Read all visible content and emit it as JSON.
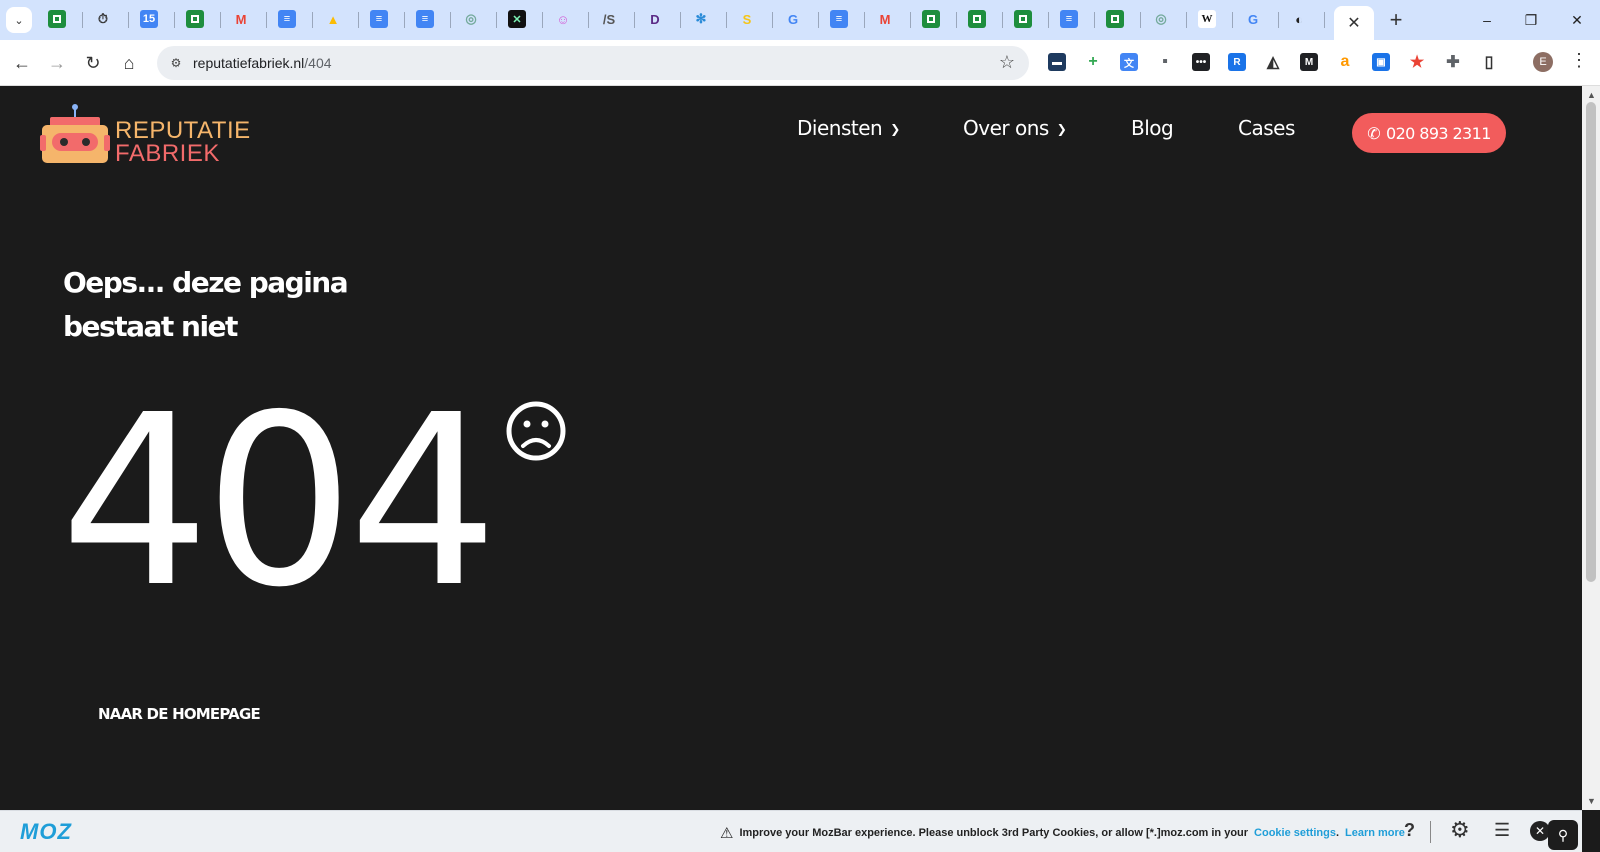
{
  "browser": {
    "url_domain": "reputatiefabriek.nl",
    "url_path": "/404",
    "avatar_letter": "E",
    "tab_close": "✕",
    "new_tab": "+",
    "window_controls": [
      "–",
      "❐",
      "✕"
    ],
    "tab_favicons": [
      {
        "icon": "sheets-icon",
        "glyph": "",
        "color": "#1e8e3e"
      },
      {
        "icon": "timer-icon",
        "glyph": "⏱",
        "color": "#333333"
      },
      {
        "icon": "calendar-icon",
        "glyph": "15",
        "color": "#4285f4"
      },
      {
        "icon": "sheets-icon",
        "glyph": "",
        "color": "#1e8e3e"
      },
      {
        "icon": "gmail-icon",
        "glyph": "M",
        "color": "#ea4335"
      },
      {
        "icon": "docs-icon",
        "glyph": "≡",
        "color": "#4285f4"
      },
      {
        "icon": "drive-icon",
        "glyph": "▲",
        "color": "#fbbc04"
      },
      {
        "icon": "docs-icon",
        "glyph": "≡",
        "color": "#4285f4"
      },
      {
        "icon": "docs-icon",
        "glyph": "≡",
        "color": "#4285f4"
      },
      {
        "icon": "chatgpt-icon",
        "glyph": "◎",
        "color": "#74aa9c"
      },
      {
        "icon": "x-app-icon",
        "glyph": "✕",
        "color": "#111111"
      },
      {
        "icon": "ai-icon",
        "glyph": "☺",
        "color": "#d35dd6"
      },
      {
        "icon": "as-icon",
        "glyph": "/S",
        "color": "#555555"
      },
      {
        "icon": "d-app-icon",
        "glyph": "D",
        "color": "#5b2a86"
      },
      {
        "icon": "flower-icon",
        "glyph": "✻",
        "color": "#2a8bd8"
      },
      {
        "icon": "s-app-icon",
        "glyph": "S",
        "color": "#f5c518"
      },
      {
        "icon": "google-icon",
        "glyph": "G",
        "color": "#4285f4"
      },
      {
        "icon": "docs-icon",
        "glyph": "≡",
        "color": "#4285f4"
      },
      {
        "icon": "gmail-icon",
        "glyph": "M",
        "color": "#ea4335"
      },
      {
        "icon": "sheets-icon",
        "glyph": "",
        "color": "#1e8e3e"
      },
      {
        "icon": "sheets-icon",
        "glyph": "",
        "color": "#1e8e3e"
      },
      {
        "icon": "sheets-icon",
        "glyph": "",
        "color": "#1e8e3e"
      },
      {
        "icon": "docs-icon",
        "glyph": "≡",
        "color": "#4285f4"
      },
      {
        "icon": "sheets-icon",
        "glyph": "",
        "color": "#1e8e3e"
      },
      {
        "icon": "chatgpt-icon",
        "glyph": "◎",
        "color": "#74aa9c"
      },
      {
        "icon": "wikipedia-icon",
        "glyph": "W",
        "color": "#ffffff"
      },
      {
        "icon": "google-icon",
        "glyph": "G",
        "color": "#4285f4"
      },
      {
        "icon": "cursor-icon",
        "glyph": "◐",
        "color": "#222222"
      }
    ],
    "extensions": [
      {
        "icon": "wallet-icon",
        "glyph": "▬",
        "color": "#1e3a5f"
      },
      {
        "icon": "plus-extension-icon",
        "glyph": "+",
        "color": "#34a853"
      },
      {
        "icon": "translate-icon",
        "glyph": "文",
        "color": "#4285f4"
      },
      {
        "icon": "stamp-icon",
        "glyph": "▪",
        "color": "#5f6368"
      },
      {
        "icon": "dots-extension-icon",
        "glyph": "•••",
        "color": "#202124"
      },
      {
        "icon": "r-extension-icon",
        "glyph": "R",
        "color": "#1a73e8"
      },
      {
        "icon": "bird-icon",
        "glyph": "◭",
        "color": "#333333"
      },
      {
        "icon": "m-extension-icon",
        "glyph": "M",
        "color": "#202124"
      },
      {
        "icon": "amazon-icon",
        "glyph": "a",
        "color": "#ff9900"
      },
      {
        "icon": "screen-extension-icon",
        "glyph": "▣",
        "color": "#1a73e8"
      },
      {
        "icon": "star-extension-icon",
        "glyph": "★",
        "color": "#ea4335"
      },
      {
        "icon": "puzzle-icon",
        "glyph": "✚",
        "color": "#5f6368"
      },
      {
        "icon": "sidepanel-icon",
        "glyph": "▯",
        "color": "#333333"
      }
    ]
  },
  "site": {
    "logo_line1": "REPUTATIE",
    "logo_line2": "FABRIEK",
    "nav": {
      "diensten": "Diensten",
      "over_ons": "Over ons",
      "blog": "Blog",
      "cases": "Cases"
    },
    "phone": "020 893 2311",
    "headline": "Oeps... deze pagina bestaat niet",
    "error_code": "404",
    "home_link": "NAAR DE HOMEPAGE",
    "colors": {
      "background": "#1b1b1b",
      "accent": "#f25c5c",
      "logo_orange": "#f5b56b",
      "logo_red": "#f26b6b"
    }
  },
  "mozbar": {
    "logo": "MOZ",
    "message": "Improve your MozBar experience. Please unblock 3rd Party Cookies, or allow [*.]moz.com in your",
    "cookie_link": "Cookie settings",
    "period": ".",
    "learn_more": "Learn more",
    "help": "?"
  }
}
